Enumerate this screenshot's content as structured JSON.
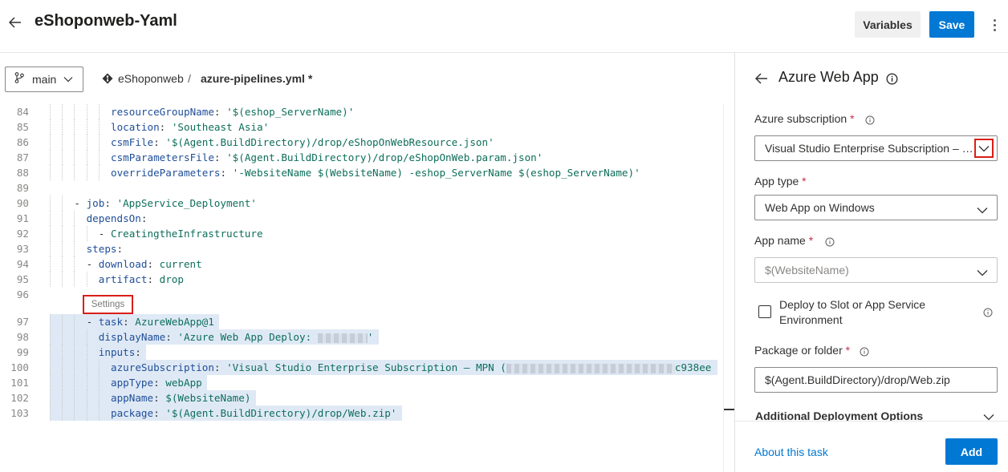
{
  "header": {
    "title": "eShoponweb-Yaml",
    "variables_label": "Variables",
    "save_label": "Save"
  },
  "toolbar": {
    "branch": "main",
    "repo": "eShoponweb",
    "separator": "/",
    "file": "azure-pipelines.yml *"
  },
  "editor": {
    "settings_label": "Settings",
    "lines": [
      {
        "n": "84",
        "indent": 10,
        "html": "<span class=\"k\">resourceGroupName</span><span class=\"p\">: </span><span class=\"s\">'$(eshop_ServerName)'</span>"
      },
      {
        "n": "85",
        "indent": 10,
        "html": "<span class=\"k\">location</span><span class=\"p\">: </span><span class=\"s\">'Southeast Asia'</span>"
      },
      {
        "n": "86",
        "indent": 10,
        "html": "<span class=\"k\">csmFile</span><span class=\"p\">: </span><span class=\"s\">'$(Agent.BuildDirectory)/drop/eShopOnWebResource.json'</span>"
      },
      {
        "n": "87",
        "indent": 10,
        "html": "<span class=\"k\">csmParametersFile</span><span class=\"p\">: </span><span class=\"s\">'$(Agent.BuildDirectory)/drop/eShopOnWeb.param.json'</span>"
      },
      {
        "n": "88",
        "indent": 10,
        "html": "<span class=\"k\">overrideParameters</span><span class=\"p\">: </span><span class=\"s\">'-WebsiteName $(WebsiteName) -eshop_ServerName $(eshop_ServerName)'</span>"
      },
      {
        "n": "89",
        "indent": 0,
        "html": ""
      },
      {
        "n": "90",
        "indent": 4,
        "html": "<span class=\"p\">- </span><span class=\"k\">job</span><span class=\"p\">: </span><span class=\"s\">'AppService_Deployment'</span>"
      },
      {
        "n": "91",
        "indent": 6,
        "html": "<span class=\"k\">dependsOn</span><span class=\"p\">:</span>"
      },
      {
        "n": "92",
        "indent": 8,
        "html": "<span class=\"p\">- </span><span class=\"s\">CreatingtheInfrastructure</span>"
      },
      {
        "n": "93",
        "indent": 6,
        "html": "<span class=\"k\">steps</span><span class=\"p\">:</span>"
      },
      {
        "n": "94",
        "indent": 6,
        "html": "<span class=\"p\">- </span><span class=\"k\">download</span><span class=\"p\">: </span><span class=\"s\">current</span>"
      },
      {
        "n": "95",
        "indent": 8,
        "html": "<span class=\"k\">artifact</span><span class=\"p\">: </span><span class=\"s\">drop</span>"
      },
      {
        "n": "96",
        "indent": 0,
        "html": ""
      },
      {
        "n": "97",
        "indent": 6,
        "html": "<span class=\"p\">- </span><span class=\"k\">task</span><span class=\"p\">: </span><span class=\"s\">AzureWebApp@1</span>"
      },
      {
        "n": "98",
        "indent": 8,
        "html": "<span class=\"k\">displayName</span><span class=\"p\">: </span><span class=\"s\">'Azure Web App Deploy: </span><span class=\"redact\" style=\"width:62px\"></span><span class=\"s\">'</span>"
      },
      {
        "n": "99",
        "indent": 8,
        "html": "<span class=\"k\">inputs</span><span class=\"p\">:</span>"
      },
      {
        "n": "100",
        "indent": 10,
        "html": "<span class=\"k\">azureSubscription</span><span class=\"p\">: </span><span class=\"s\">'Visual Studio Enterprise Subscription – MPN (</span><span class=\"redact\" style=\"width:210px\"></span><span class=\"s\">c938ee</span>"
      },
      {
        "n": "101",
        "indent": 10,
        "html": "<span class=\"k\">appType</span><span class=\"p\">: </span><span class=\"s\">webApp</span>"
      },
      {
        "n": "102",
        "indent": 10,
        "html": "<span class=\"k\">appName</span><span class=\"p\">: </span><span class=\"s\">$(WebsiteName)</span>"
      },
      {
        "n": "103",
        "indent": 10,
        "html": "<span class=\"k\">package</span><span class=\"p\">: </span><span class=\"s\">'$(Agent.BuildDirectory)/drop/Web.zip'</span>"
      }
    ]
  },
  "panel": {
    "title": "Azure Web App",
    "fields": {
      "subscription_label": "Azure subscription",
      "subscription_value": "Visual Studio Enterprise Subscription – MPN",
      "apptype_label": "App type",
      "apptype_value": "Web App on Windows",
      "appname_label": "App name",
      "appname_placeholder": "$(WebsiteName)",
      "deploy_slot_label": "Deploy to Slot or App Service Environment",
      "package_label": "Package or folder",
      "package_value": "$(Agent.BuildDirectory)/drop/Web.zip",
      "additional_options": "Additional Deployment Options"
    },
    "required_mark": "*",
    "about_link": "About this task",
    "add_label": "Add"
  }
}
